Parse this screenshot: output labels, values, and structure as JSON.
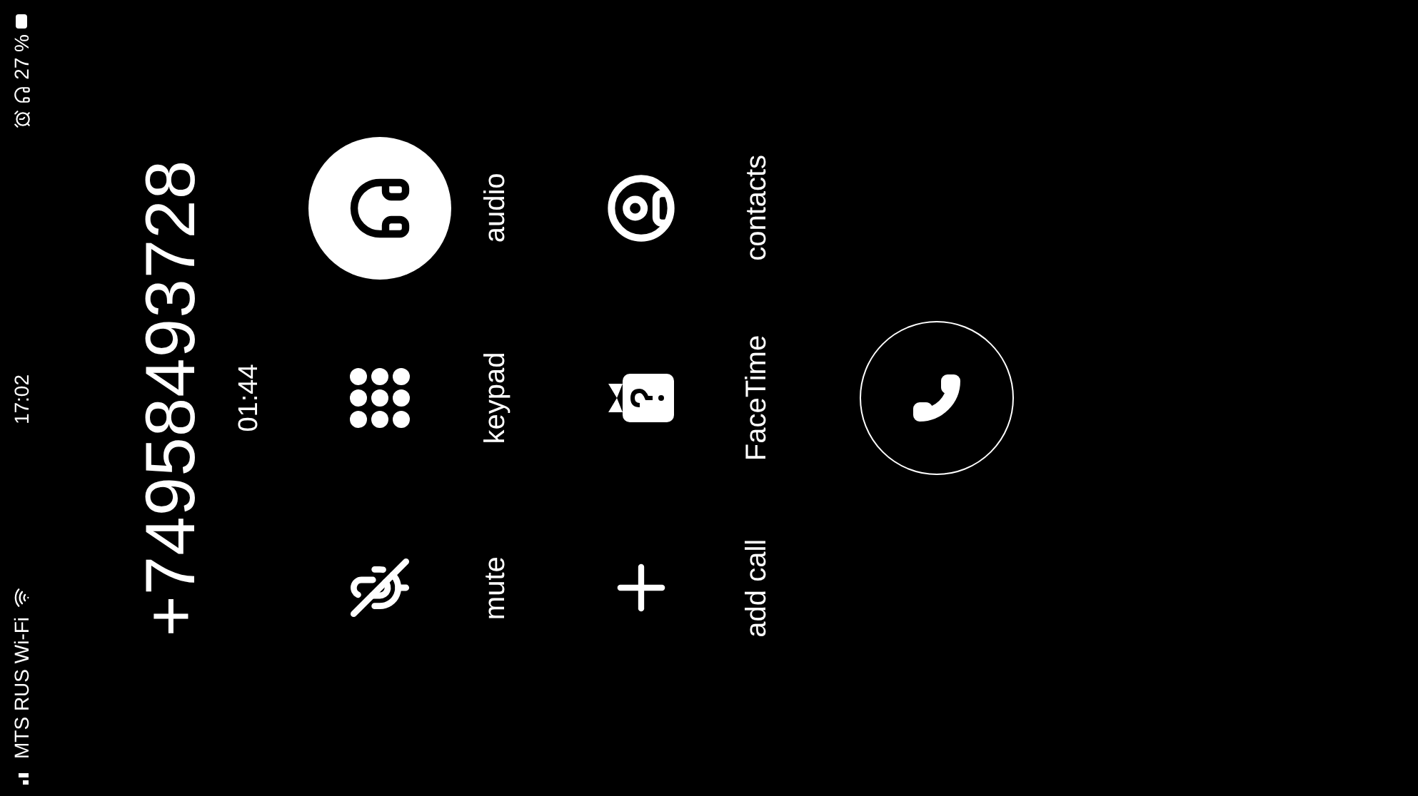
{
  "status_bar": {
    "carrier": "MTS RUS Wi-Fi",
    "time": "17:02",
    "battery": "27 %"
  },
  "call": {
    "number": "+74958493728",
    "duration": "01:44"
  },
  "controls": [
    {
      "label": "mute",
      "kind": "mute",
      "selected": false
    },
    {
      "label": "keypad",
      "kind": "keypad",
      "selected": false
    },
    {
      "label": "audio",
      "kind": "audio",
      "selected": true
    },
    {
      "label": "add call",
      "kind": "add",
      "selected": false
    },
    {
      "label": "FaceTime",
      "kind": "facetime",
      "selected": false
    },
    {
      "label": "contacts",
      "kind": "contacts",
      "selected": false
    }
  ]
}
